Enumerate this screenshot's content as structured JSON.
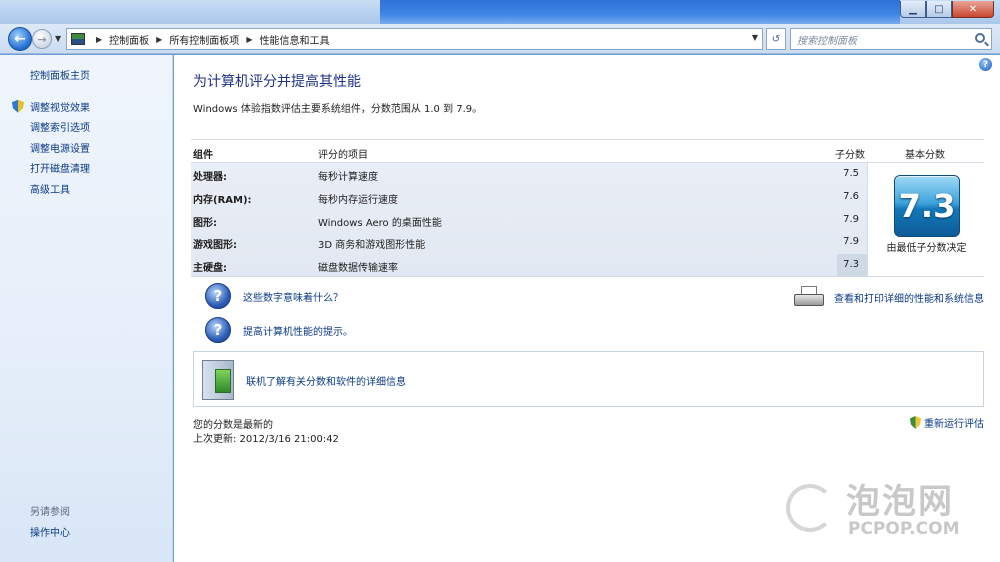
{
  "window": {
    "min_label": "▁",
    "max_label": "□",
    "close_label": "✕"
  },
  "nav": {
    "back_label": "←",
    "forward_label": "→",
    "breadcrumbs": [
      "控制面板",
      "所有控制面板项",
      "性能信息和工具"
    ],
    "search_placeholder": "搜索控制面板",
    "refresh_label": "↺"
  },
  "sidebar": {
    "home": "控制面板主页",
    "tasks": [
      {
        "label": "调整视觉效果",
        "icon": "shield-icon"
      },
      {
        "label": "调整索引选项",
        "icon": ""
      },
      {
        "label": "调整电源设置",
        "icon": ""
      },
      {
        "label": "打开磁盘清理",
        "icon": ""
      },
      {
        "label": "高级工具",
        "icon": ""
      }
    ],
    "see_also": "另请参阅",
    "action_center": "操作中心"
  },
  "main": {
    "title": "为计算机评分并提高其性能",
    "subtitle": "Windows 体验指数评估主要系统组件，分数范围从 1.0 到 7.9。",
    "table": {
      "headers": {
        "component": "组件",
        "item": "评分的项目",
        "subscore": "子分数",
        "basescore": "基本分数"
      },
      "rows": [
        {
          "component": "处理器:",
          "item": "每秒计算速度",
          "subscore": "7.5"
        },
        {
          "component": "内存(RAM):",
          "item": "每秒内存运行速度",
          "subscore": "7.6"
        },
        {
          "component": "图形:",
          "item": "Windows Aero 的桌面性能",
          "subscore": "7.9"
        },
        {
          "component": "游戏图形:",
          "item": "3D 商务和游戏图形性能",
          "subscore": "7.9"
        },
        {
          "component": "主硬盘:",
          "item": "磁盘数据传输速率",
          "subscore": "7.3"
        }
      ],
      "base_score": "7.3",
      "base_caption": "由最低子分数决定"
    },
    "links": {
      "what_numbers_mean": "这些数字意味着什么？",
      "improve_tips": "提高计算机性能的提示。",
      "print_details": "查看和打印详细的性能和系统信息",
      "learn_online": "联机了解有关分数和软件的详细信息"
    },
    "status": {
      "current": "您的分数是最新的",
      "last_update": "上次更新: 2012/3/16 21:00:42",
      "rerun": "重新运行评估"
    },
    "help_label": "?"
  },
  "watermark": {
    "cn": "泡泡网",
    "en": "PCPOP.COM"
  },
  "colors": {
    "title": "#1e3287",
    "link": "#0b3a86",
    "badge": "#1479b8",
    "sidebar_bg": "#e5eefa"
  }
}
